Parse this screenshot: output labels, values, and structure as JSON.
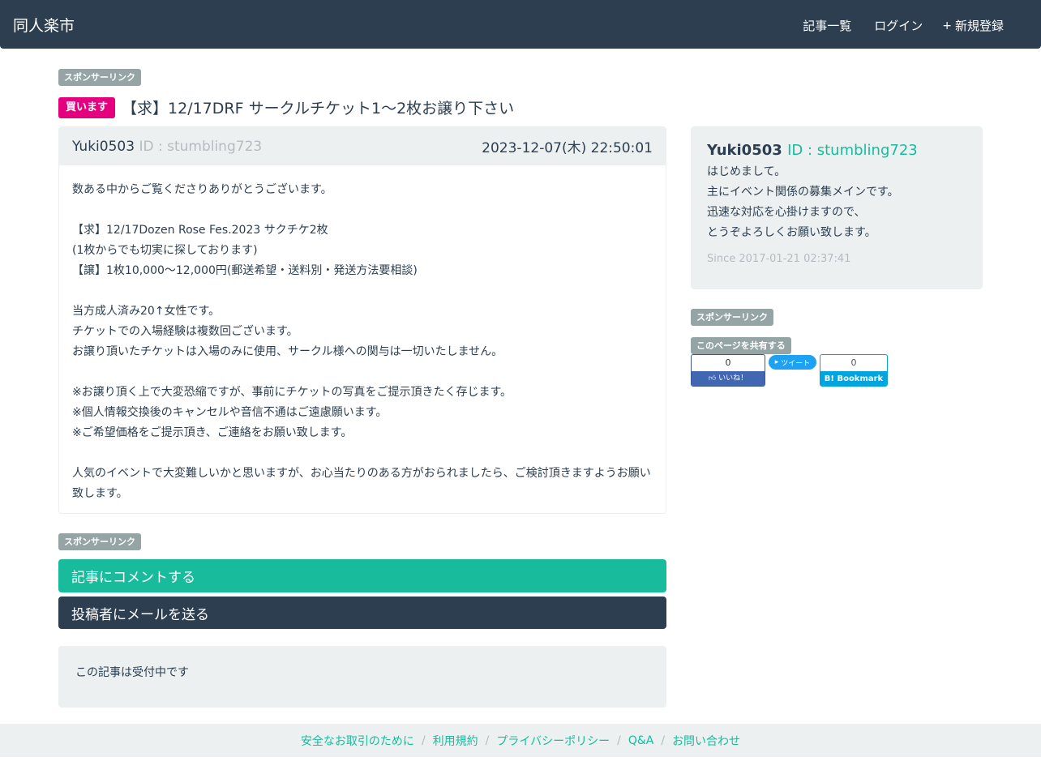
{
  "nav": {
    "brand": "同人楽市",
    "links": [
      {
        "icon": "",
        "label": "記事一覧"
      },
      {
        "icon": "",
        "label": "ログイン"
      },
      {
        "icon": "+",
        "label": "新規登録"
      }
    ]
  },
  "sponsor_label": "スポンサーリンク",
  "post": {
    "badge": "買います",
    "title": "【求】12/17DRF サークルチケット1〜2枚お譲り下さい",
    "author_icon": "",
    "author": "Yuki0503",
    "author_id": "ID : stumbling723",
    "date_icon": "",
    "date": "2023-12-07(木) 22:50:01",
    "body_lines": [
      "数ある中からご覧くださりありがとうございます。",
      "",
      "【求】12/17Dozen Rose Fes.2023 サクチケ2枚",
      "(1枚からでも切実に探しております)",
      "【譲】1枚10,000〜12,000円(郵送希望・送料別・発送方法要相談)",
      "",
      "当方成人済み20↑女性です。",
      "チケットでの入場経験は複数回ございます。",
      "お譲り頂いたチケットは入場のみに使用、サークル様への関与は一切いたしません。",
      "",
      "※お譲り頂く上で大変恐縮ですが、事前にチケットの写真をご提示頂きたく存じます。",
      "※個人情報交換後のキャンセルや音信不通はご遠慮願います。",
      "※ご希望価格をご提示頂き、ご連絡をお願い致します。",
      "",
      "人気のイベントで大変難しいかと思いますが、お心当たりのある方がおられましたら、ご検討頂きますようお願い致します。"
    ]
  },
  "actions": {
    "comment": "記事にコメントする",
    "mail": "投稿者にメールを送る",
    "status": "この記事は受付中です"
  },
  "profile": {
    "icon": "",
    "name": "Yuki0503",
    "id": "ID : stumbling723",
    "lines": [
      "はじめまして。",
      "主にイベント関係の募集メインです。",
      "迅速な対応を心掛けますので、",
      "とうぞよろしくお願い致します。"
    ],
    "since_icon": "",
    "since": "Since 2017-01-21 02:37:41"
  },
  "share": {
    "label": "このページを共有する",
    "fb_count": "0",
    "fb_label": "いいね！",
    "tw_label": "ツイート",
    "hb_count": "0",
    "hb_label": "B! Bookmark"
  },
  "footer": {
    "links": [
      "安全なお取引のために",
      "利用規約",
      "プライバシーポリシー",
      "Q&A",
      "お問い合わせ"
    ]
  },
  "colors": {
    "navbar": "#2c3e50",
    "accent": "#18bc9c",
    "badge": "#e5007e",
    "well": "#ecf0f1"
  }
}
